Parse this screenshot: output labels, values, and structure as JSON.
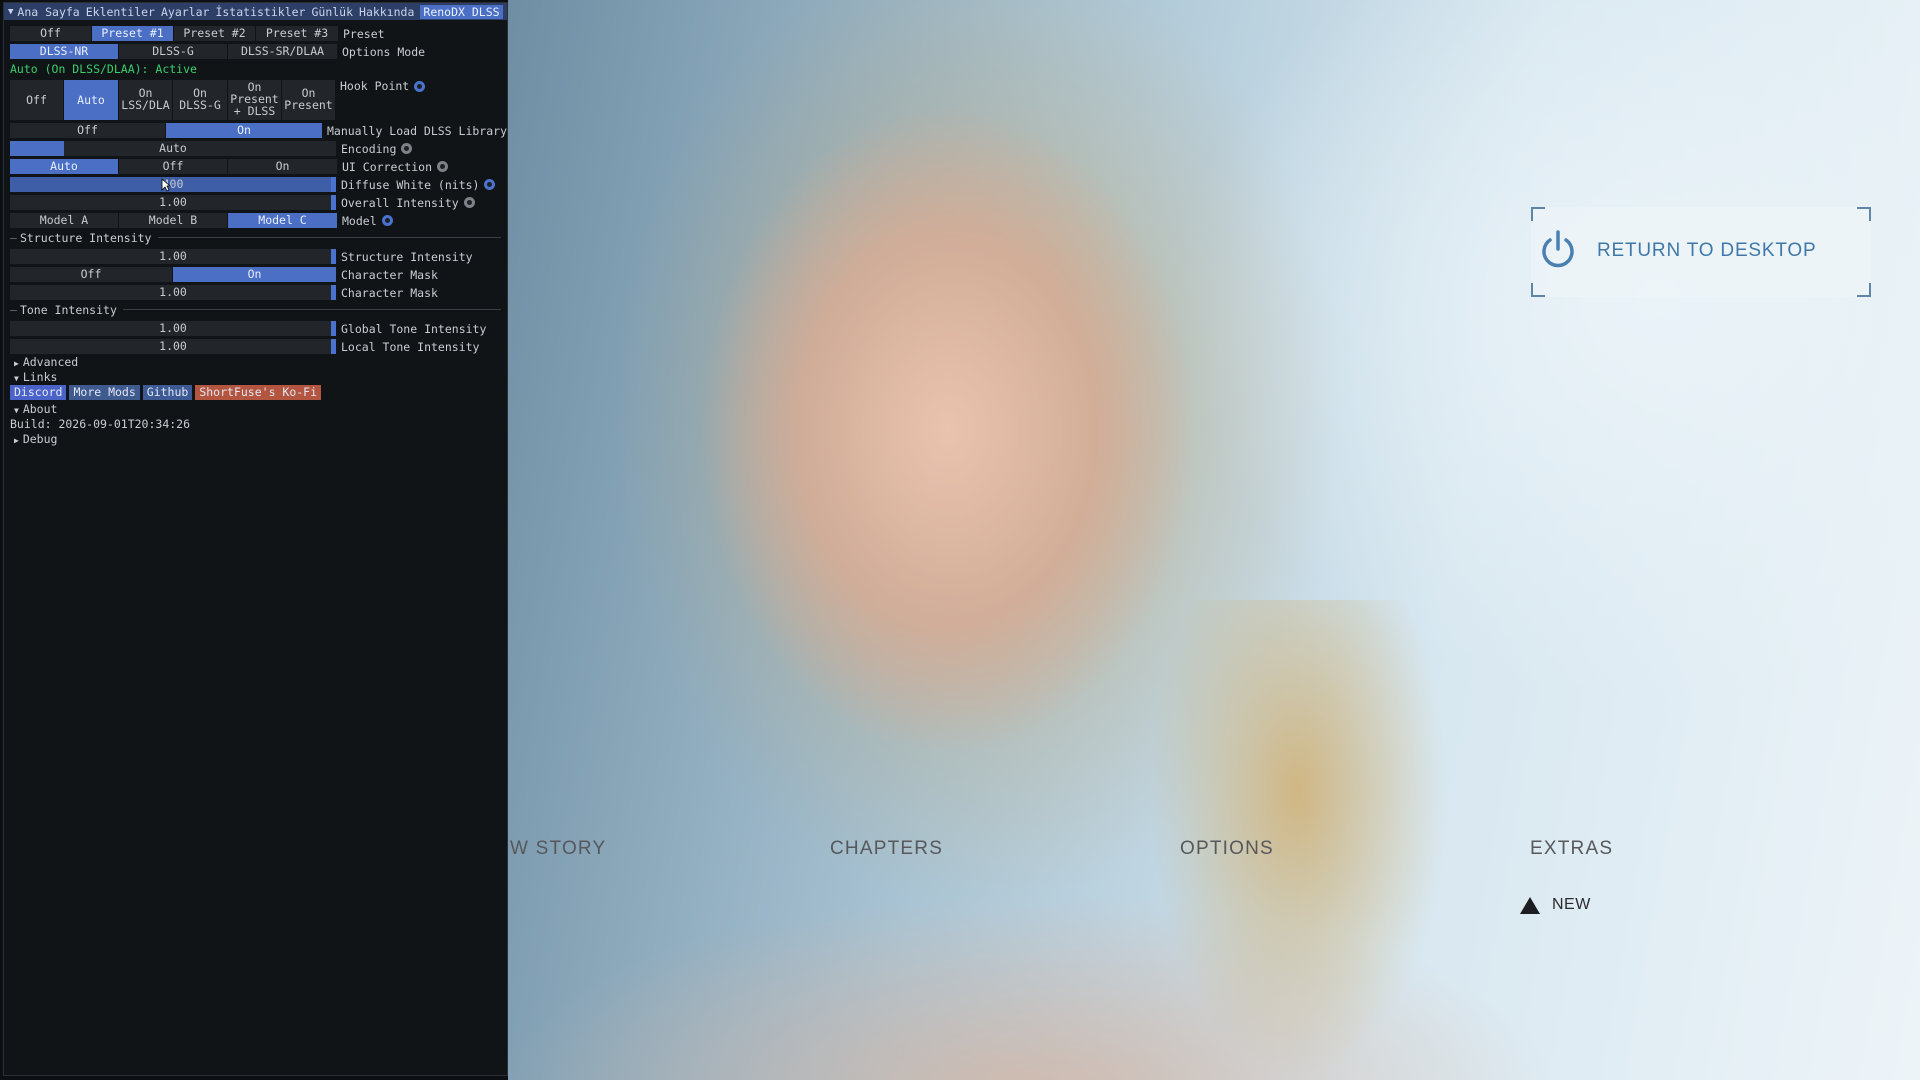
{
  "panel": {
    "tabs": [
      "Ana Sayfa",
      "Eklentiler",
      "Ayarlar",
      "İstatistikler",
      "Günlük",
      "Hakkında",
      "RenoDX DLSS"
    ],
    "active_tab": "RenoDX DLSS",
    "preset": {
      "options": [
        "Off",
        "Preset #1",
        "Preset #2",
        "Preset #3"
      ],
      "selected": "Preset #1",
      "label": "Preset"
    },
    "options_mode": {
      "options": [
        "DLSS-NR",
        "DLSS-G",
        "DLSS-SR/DLAA"
      ],
      "selected": "DLSS-NR",
      "label": "Options Mode"
    },
    "status_text": "Auto (On DLSS/DLAA): Active",
    "hook_point": {
      "options": [
        "Off",
        "Auto",
        "On\nLSS/DLA",
        "On\nDLSS-G",
        "On\nPresent\n+ DLSS",
        "On\nPresent"
      ],
      "selected": "Auto",
      "label": "Hook Point"
    },
    "manual_load": {
      "options": [
        "Off",
        "On"
      ],
      "selected": "On",
      "label": "Manually Load DLSS Library"
    },
    "encoding": {
      "value": "Auto",
      "label": "Encoding"
    },
    "ui_correction": {
      "options": [
        "Auto",
        "Off",
        "On"
      ],
      "selected": "Auto",
      "label": "UI Correction"
    },
    "diffuse_white": {
      "value": "400",
      "label": "Diffuse White (nits)"
    },
    "overall_intensity": {
      "value": "1.00",
      "label": "Overall Intensity"
    },
    "model": {
      "options": [
        "Model A",
        "Model B",
        "Model C"
      ],
      "selected": "Model C",
      "label": "Model"
    },
    "structure_section": "Structure Intensity",
    "structure_intensity": {
      "value": "1.00",
      "label": "Structure Intensity"
    },
    "character_mask_toggle": {
      "options": [
        "Off",
        "On"
      ],
      "selected": "On",
      "label": "Character Mask"
    },
    "character_mask_value": {
      "value": "1.00",
      "label": "Character Mask"
    },
    "tone_section": "Tone Intensity",
    "global_tone": {
      "value": "1.00",
      "label": "Global Tone Intensity"
    },
    "local_tone": {
      "value": "1.00",
      "label": "Local Tone Intensity"
    },
    "tree": {
      "advanced": "Advanced",
      "links": "Links",
      "about": "About",
      "debug": "Debug"
    },
    "links": [
      "Discord",
      "More Mods",
      "Github",
      "ShortFuse's Ko-Fi"
    ],
    "link_colors": [
      "#4b63c9",
      "#3f5a8f",
      "#3e5a95",
      "#b3553f"
    ],
    "build": "Build: 2026-09-01T20:34:26",
    "accent_color": "#4a6fc4"
  },
  "game": {
    "menu": [
      "W STORY",
      "CHAPTERS",
      "OPTIONS",
      "EXTRAS"
    ],
    "new_badge": "NEW",
    "return_label": "RETURN TO DESKTOP"
  }
}
